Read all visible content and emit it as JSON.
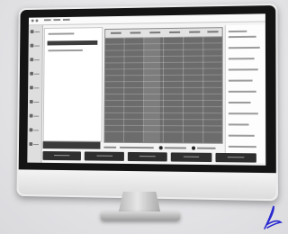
{
  "scene": {
    "subject": "desktop-monitor",
    "screen_content": "spreadsheet-application",
    "colors": {
      "bezel": "#141414",
      "body": "#ececec",
      "grid_fill": "#6c6c6c",
      "button_fill": "#2f2f2f"
    }
  },
  "icons": [
    "window-controls-icon",
    "nav-icon",
    "signature-mark-icon"
  ]
}
